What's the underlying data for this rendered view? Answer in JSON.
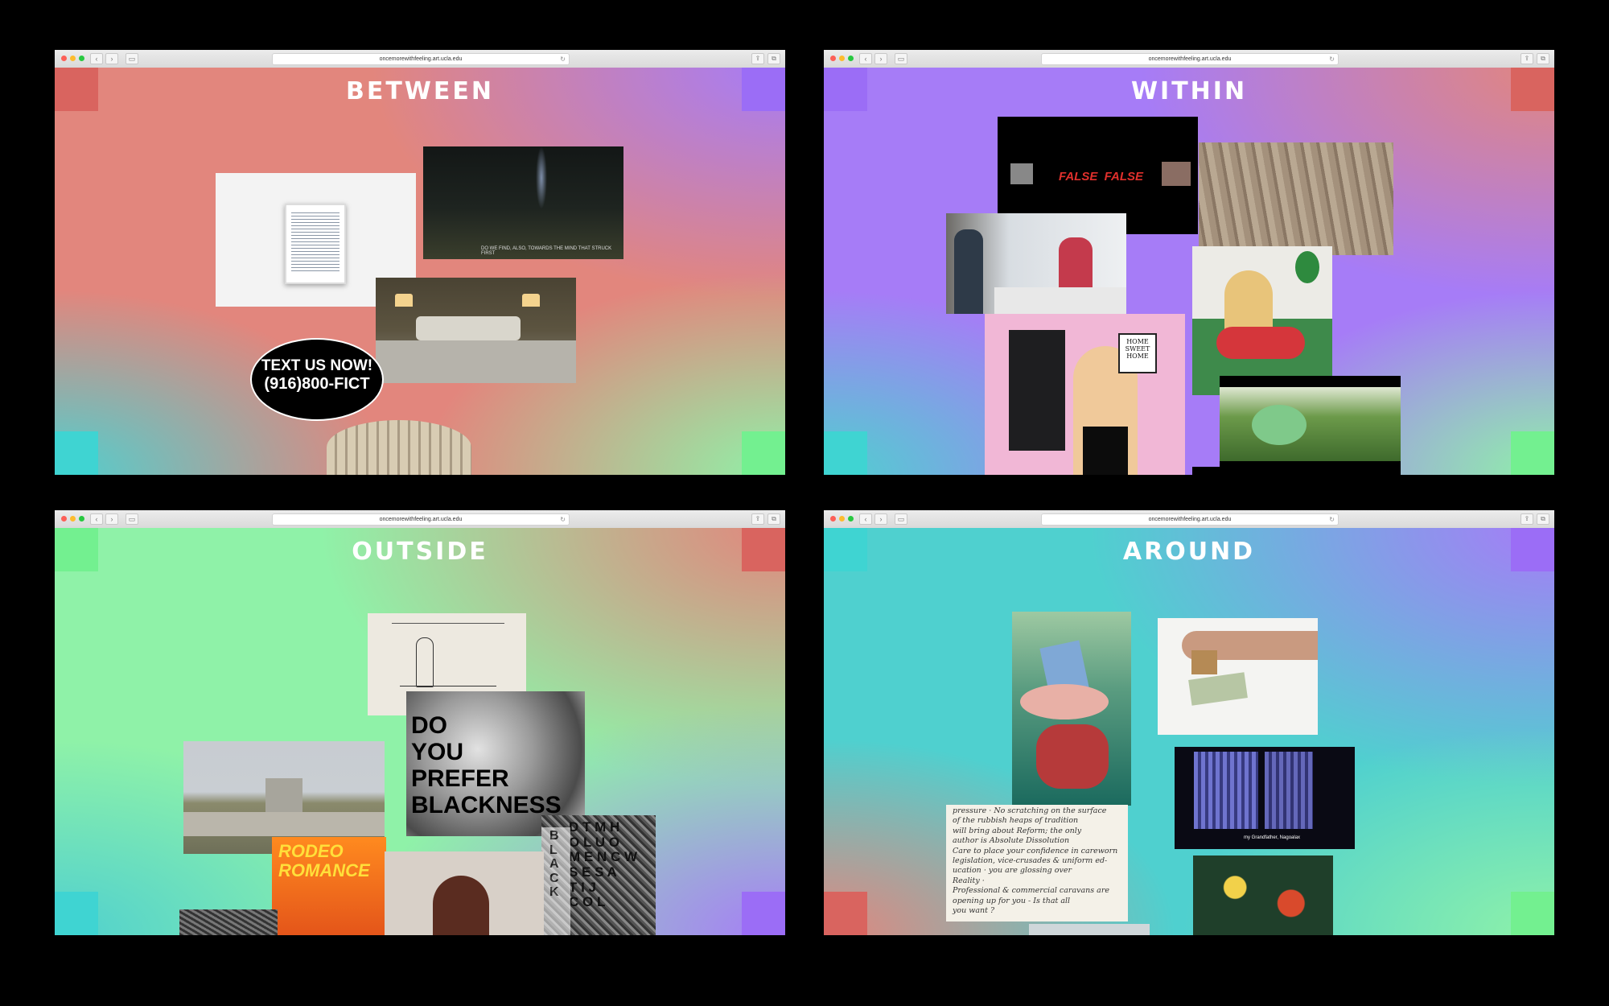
{
  "browser": {
    "url": "oncemorewithfeeling.art.ucla.edu",
    "back_icon": "‹",
    "forward_icon": "›",
    "sidebar_icon": "▭",
    "share_icon": "⇪",
    "tabs_icon": "⧉",
    "reload_icon": "↻",
    "add_icon": "+"
  },
  "colors": {
    "salmon": "#e2867d",
    "violet": "#a67cf7",
    "mint": "#8ff2a8",
    "teal": "#4fd0cf",
    "red_corner": "#d9645f",
    "purple_corner": "#9b6df6",
    "green_corner": "#73f090",
    "cyan_corner": "#3fd4d2"
  },
  "panels": {
    "between": {
      "title": "BETWEEN",
      "video_caption": "DO WE FIND, ALSO, TOWARDS THE MIND THAT STRUCK FIRST",
      "badge_line1": "TEXT US NOW!",
      "badge_line2": "(916)800-FICT"
    },
    "within": {
      "title": "WITHIN",
      "false_text": "FALSE  FALSE",
      "sign_text": "HOME SWEET HOME"
    },
    "outside": {
      "title": "OUTSIDE",
      "poster_text": "DO\nYOU\nPREFER\nBLACKNESS",
      "rodeo_text": "RODEO\nROMANCE",
      "letter_grid": "D T M H\nO L U O\nM E N C W\nS E S A\nT I J\nC O L",
      "black_text": "B\nL\nA\nC\nK"
    },
    "around": {
      "title": "AROUND",
      "video_caption": "my Grandfather, Nagoalax",
      "note_text": "pressure · No scratching on the surface\nof the rubbish heaps of tradition\nwill bring about Reform; the only\nauthor is Absolute Dissolution\nCare to place your confidence in careworn\nlegislation, vice-crusades & uniform ed-\nucation · you are glossing over\nReality ·\nProfessional & commercial caravans are\nopening up for you - Is that all\nyou want ?"
    }
  }
}
